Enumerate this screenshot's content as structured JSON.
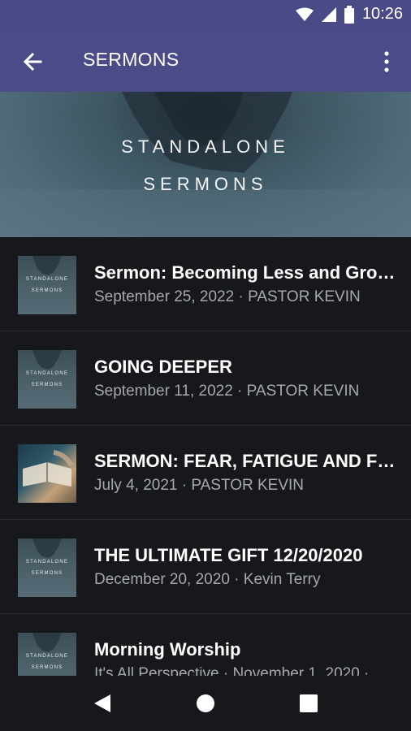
{
  "status_bar": {
    "time": "10:26"
  },
  "app_bar": {
    "title": "SERMONS"
  },
  "hero": {
    "line1": "STANDALONE",
    "line2": "SERMONS"
  },
  "thumb_text": {
    "line1": "STANDALONE",
    "line2": "SERMONS"
  },
  "sermons": [
    {
      "title": "Sermon: Becoming Less and Gro…",
      "subtitle": "September 25, 2022 · PASTOR KEVIN"
    },
    {
      "title": "GOING DEEPER",
      "subtitle": "September 11, 2022 · PASTOR KEVIN"
    },
    {
      "title": "SERMON: FEAR, FATIGUE AND F…",
      "subtitle": "July 4, 2021 · PASTOR KEVIN"
    },
    {
      "title": "THE ULTIMATE GIFT 12/20/2020",
      "subtitle": "December 20, 2020 · Kevin Terry"
    },
    {
      "title": "Morning Worship",
      "subtitle": "It's All Perspective · November 1, 2020 · …"
    }
  ]
}
